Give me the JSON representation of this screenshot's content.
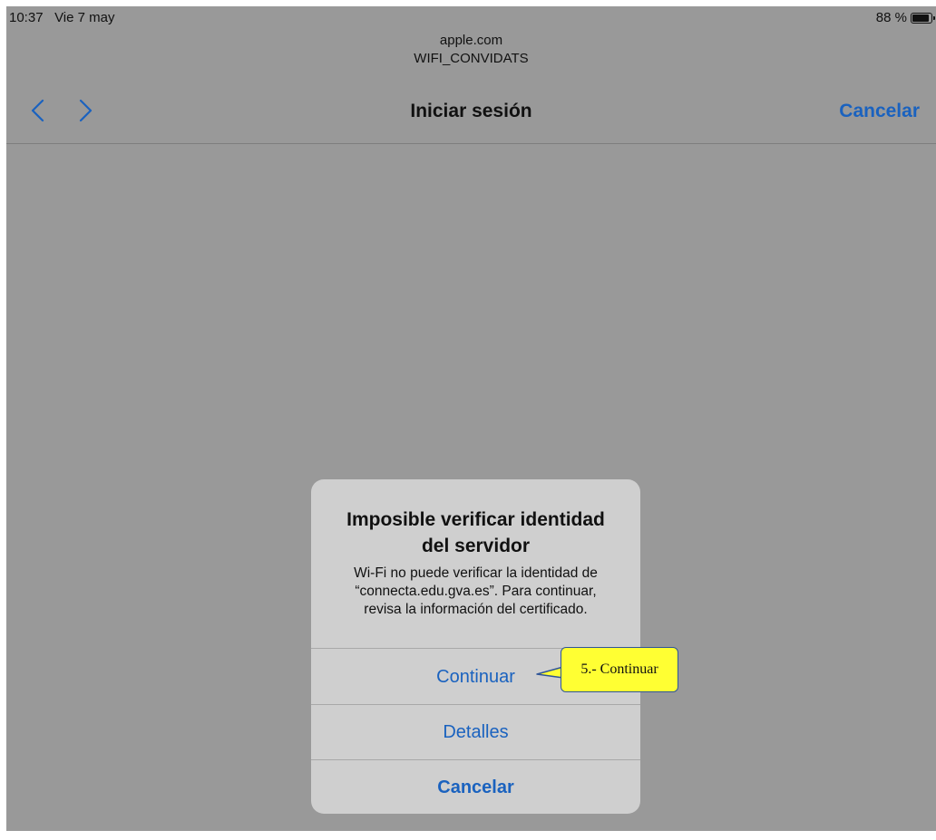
{
  "status_bar": {
    "time": "10:37",
    "date": "Vie 7 may",
    "battery_label": "88 %",
    "battery_level": 0.88,
    "battery_icon": "battery-icon"
  },
  "address": {
    "domain": "apple.com",
    "network": "WIFI_CONVIDATS"
  },
  "nav": {
    "back_icon": "chevron-left-icon",
    "forward_icon": "chevron-right-icon",
    "title": "Iniciar sesión",
    "cancel_label": "Cancelar"
  },
  "alert": {
    "title_line1": "Imposible verificar identidad",
    "title_line2": "del servidor",
    "message_line1": "Wi-Fi no puede verificar la identidad de",
    "message_line2": "“connecta.edu.gva.es”. Para continuar,",
    "message_line3": "revisa la información del certificado.",
    "buttons": [
      {
        "label": "Continuar"
      },
      {
        "label": "Detalles"
      },
      {
        "label": "Cancelar"
      }
    ]
  },
  "callout": {
    "text": "5.- Continuar"
  },
  "colors": {
    "screen_dim": "#999999",
    "accent": "#1a62bf",
    "callout_fill": "#ffff33",
    "callout_border": "#2f5597"
  }
}
